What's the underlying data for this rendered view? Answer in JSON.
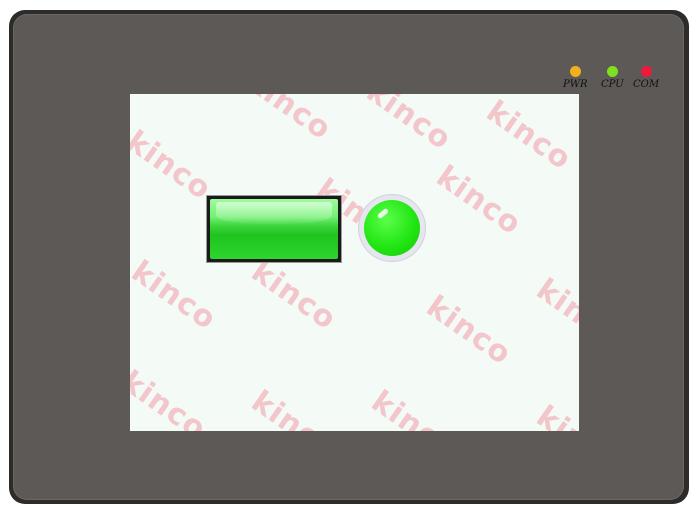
{
  "panel": {
    "leds": [
      {
        "label": "PWR",
        "color": "#f2b01e"
      },
      {
        "label": "CPU",
        "color": "#7ee01e"
      },
      {
        "label": "COM",
        "color": "#ee1a3c"
      }
    ]
  },
  "screen": {
    "background": "#f4faf6",
    "watermark": "kinco",
    "button": {
      "color": "#2ed52e",
      "state": "on"
    },
    "indicator": {
      "color": "#22e614",
      "state": "on"
    }
  }
}
